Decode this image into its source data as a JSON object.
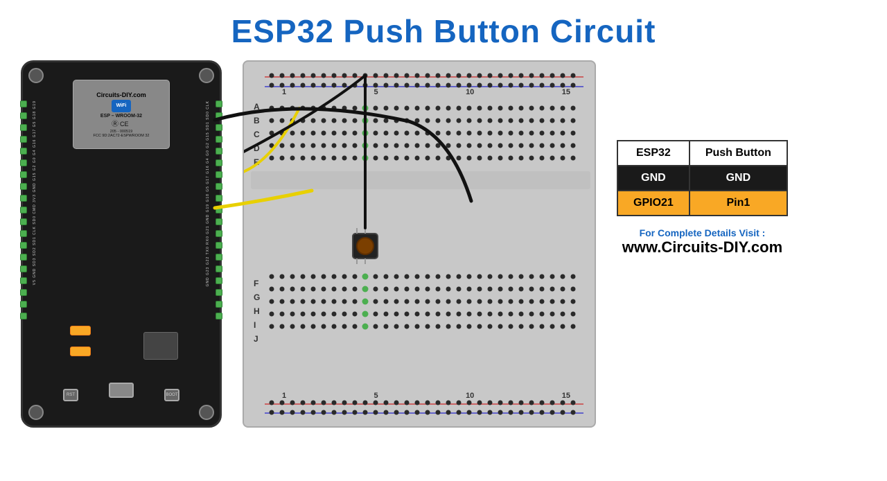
{
  "title": "ESP32 Push Button Circuit",
  "board": {
    "label": "Circuits-DIY.com",
    "wifi_label": "WiFi",
    "model": "ESP – WROOM-32",
    "ce_text": "CE",
    "fcc_text": "FCC 9D:2AC72-ESPWROOM 32",
    "id_text": "205 - 000519",
    "rst_label": "RST",
    "boot_label": "BOOT",
    "g11_label": "G11"
  },
  "table": {
    "header": [
      "ESP32",
      "Push Button"
    ],
    "rows": [
      {
        "cells": [
          "GND",
          "GND"
        ],
        "style": "black"
      },
      {
        "cells": [
          "GPIO21",
          "Pin1"
        ],
        "style": "orange"
      }
    ]
  },
  "visit": {
    "for_details": "For Complete Details Visit :",
    "url": "www.Circuits-DIY.com"
  },
  "breadboard": {
    "col_labels_top": [
      "1",
      "5",
      "10",
      "15"
    ],
    "col_labels_bot": [
      "1",
      "5",
      "10",
      "15"
    ],
    "row_labels_top": [
      "A",
      "B",
      "C",
      "D",
      "E"
    ],
    "row_labels_bot": [
      "F",
      "G",
      "H",
      "I",
      "J"
    ]
  }
}
